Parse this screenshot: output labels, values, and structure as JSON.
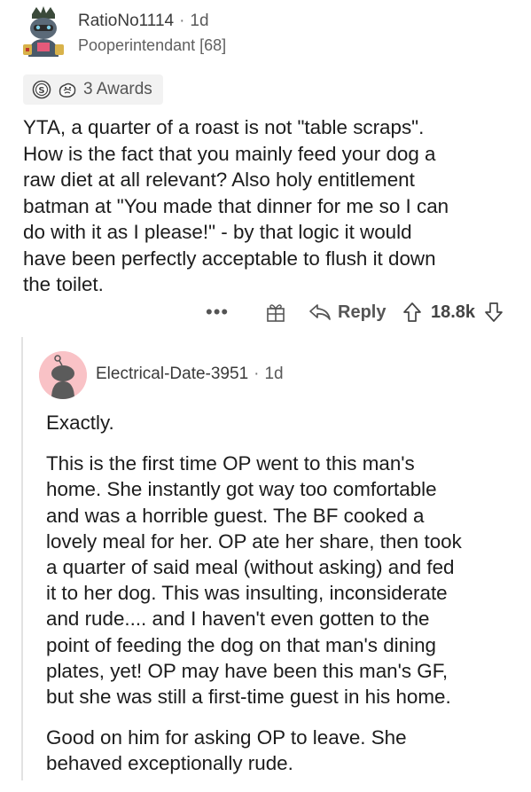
{
  "comment": {
    "username": "RatioNo1114",
    "separator": "·",
    "time": "1d",
    "flair": "Pooperintendant [68]",
    "awards_label": "3 Awards",
    "body": "YTA, a quarter of a roast is not \"table scraps\".\nHow is the fact that you mainly feed your dog a\nraw diet at all relevant? Also holy entitlement\nbatman at \"You made that dinner for me so I can\ndo with it as I please!\" - by that logic it would\nhave been perfectly acceptable to flush it down\nthe toilet.",
    "more_label": "•••",
    "reply_label": "Reply",
    "score": "18.8k"
  },
  "reply": {
    "username": "Electrical-Date-3951",
    "separator": "·",
    "time": "1d",
    "paragraphs": [
      "Exactly.",
      "This is the first time OP went to this man's\nhome. She instantly got way too comfortable\nand was a horrible guest. The BF cooked a\nlovely meal for her. OP ate her share, then took\na quarter of said meal (without asking) and fed\nit to her dog. This was insulting, inconsiderate\nand rude.... and I haven't even gotten to the\npoint of feeding the dog on that man's dining\nplates, yet! OP may have been this man's GF,\nbut she was still a first-time guest in his home.",
      "Good on him for asking OP to leave. She\nbehaved exceptionally rude."
    ]
  },
  "icons": {
    "top_avatar": "snoo-avatar",
    "award_1": "silver-award-icon",
    "award_2": "wholesome-award-icon",
    "gift": "gift-award-icon",
    "reply": "reply-arrow-icon",
    "upvote": "upvote-arrow-icon",
    "downvote": "downvote-arrow-icon",
    "reply_avatar": "default-snoo-avatar"
  },
  "colors": {
    "text": "#1c1c1c",
    "meta": "#5a5a5a",
    "reply_avatar_bg": "#f9c2c6"
  }
}
